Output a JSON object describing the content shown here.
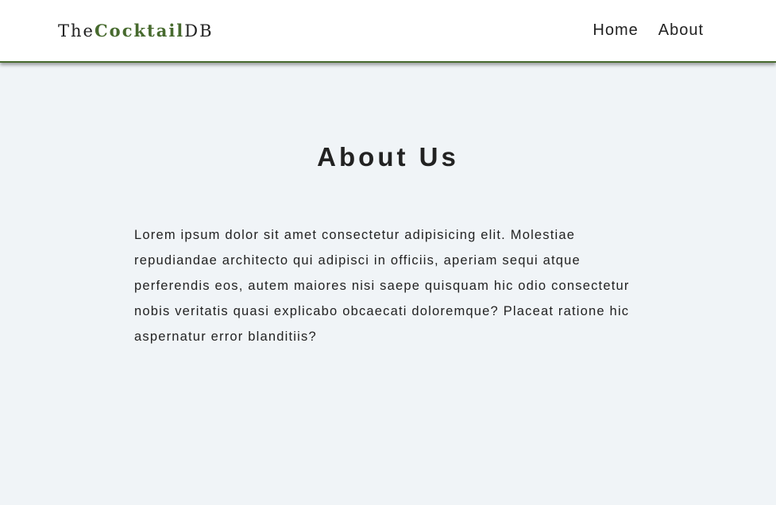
{
  "navbar": {
    "logo": {
      "prefix": "The",
      "brand": "Cocktail",
      "suffix": "DB"
    },
    "links": [
      {
        "label": "Home"
      },
      {
        "label": "About"
      }
    ]
  },
  "about": {
    "title": "About Us",
    "paragraph": "Lorem ipsum dolor sit amet consectetur adipisicing elit. Molestiae repudiandae architecto qui adipisci in officiis, aperiam sequi atque perferendis eos, autem maiores nisi saepe quisquam hic odio consectetur nobis veritatis quasi explicabo obcaecati doloremque? Placeat ratione hic aspernatur error blanditiis?"
  },
  "colors": {
    "accent": "#476a2e",
    "background": "#f0f4f7",
    "text": "#222222"
  }
}
